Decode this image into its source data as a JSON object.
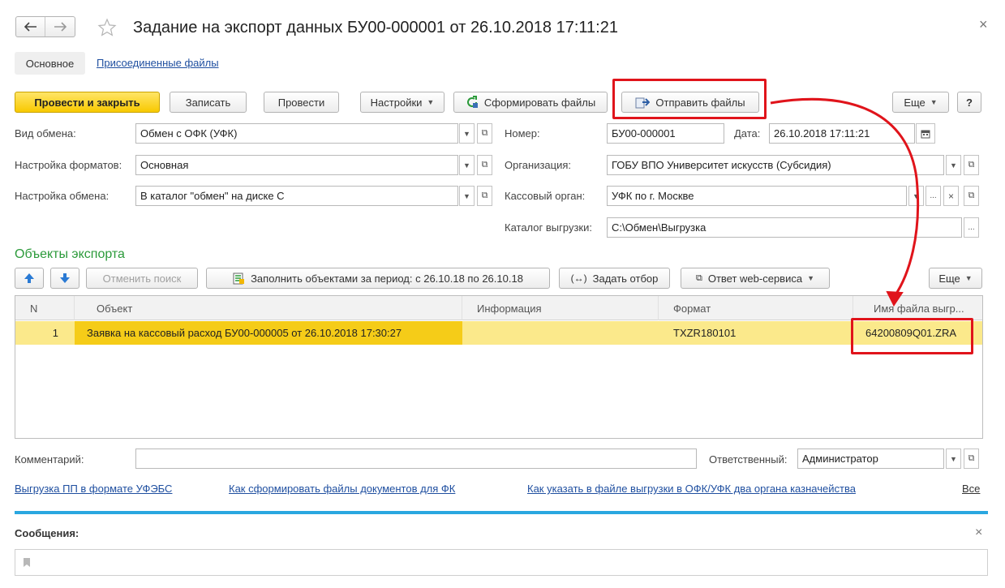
{
  "window": {
    "title": "Задание на экспорт данных БУ00-000001 от 26.10.2018 17:11:21",
    "close_glyph": "×"
  },
  "tabs": {
    "main": "Основное",
    "attached": "Присоединенные файлы"
  },
  "toolbar": {
    "post_close": "Провести и закрыть",
    "save": "Записать",
    "post": "Провести",
    "settings": "Настройки",
    "generate_files": "Сформировать файлы",
    "send_files": "Отправить файлы",
    "more": "Еще",
    "help": "?"
  },
  "form": {
    "exchange_type_label": "Вид обмена:",
    "exchange_type_value": "Обмен с ОФК (УФК)",
    "format_settings_label": "Настройка форматов:",
    "format_settings_value": "Основная",
    "exchange_settings_label": "Настройка обмена:",
    "exchange_settings_value": "В каталог \"обмен\" на диске С",
    "number_label": "Номер:",
    "number_value": "БУ00-000001",
    "date_label": "Дата:",
    "date_value": "26.10.2018 17:11:21",
    "org_label": "Организация:",
    "org_value": "ГОБУ ВПО Университет искусств (Субсидия)",
    "cash_label": "Кассовый орган:",
    "cash_value": "УФК по г. Москве",
    "export_dir_label": "Каталог выгрузки:",
    "export_dir_value": "С:\\Обмен\\Выгрузка"
  },
  "objects": {
    "section_title": "Объекты экспорта",
    "cancel_search": "Отменить поиск",
    "fill_period": "Заполнить объектами за период: с 26.10.18 по 26.10.18",
    "set_filter": "Задать отбор",
    "web_response": "Ответ web-сервиса",
    "more": "Еще",
    "columns": [
      "N",
      "Объект",
      "Информация",
      "Формат",
      "Имя файла выгр..."
    ],
    "rows": [
      {
        "n": "1",
        "object": "Заявка на кассовый расход БУ00-000005 от 26.10.2018 17:30:27",
        "info": "",
        "format": "TXZR180101",
        "filename": "64200809Q01.ZRA"
      }
    ]
  },
  "bottom": {
    "comment_label": "Комментарий:",
    "comment_value": "",
    "responsible_label": "Ответственный:",
    "responsible_value": "Администратор",
    "links": [
      "Выгрузка ПП в формате УФЭБС",
      "Как сформировать файлы документов для ФК",
      "Как указать в файле выгрузки в ОФК/УФК два органа казначейства"
    ],
    "all_link": "Все"
  },
  "messages": {
    "title": "Сообщения:",
    "close_glyph": "×"
  },
  "colors": {
    "accent_green": "#2b9a3a",
    "primary_yellow": "#f8c900",
    "selected_row": "#fbe98b",
    "selected_cell": "#f5cc18",
    "divider_blue": "#2aa7e0",
    "annotation_red": "#e0141b"
  },
  "icons": [
    "back-arrow-icon",
    "forward-arrow-icon",
    "star-icon",
    "refresh-generate-icon",
    "send-files-icon",
    "arrow-up-icon",
    "arrow-down-icon",
    "fill-table-icon",
    "filter-icon",
    "web-service-icon",
    "calendar-icon",
    "open-icon",
    "bookmark-icon"
  ]
}
